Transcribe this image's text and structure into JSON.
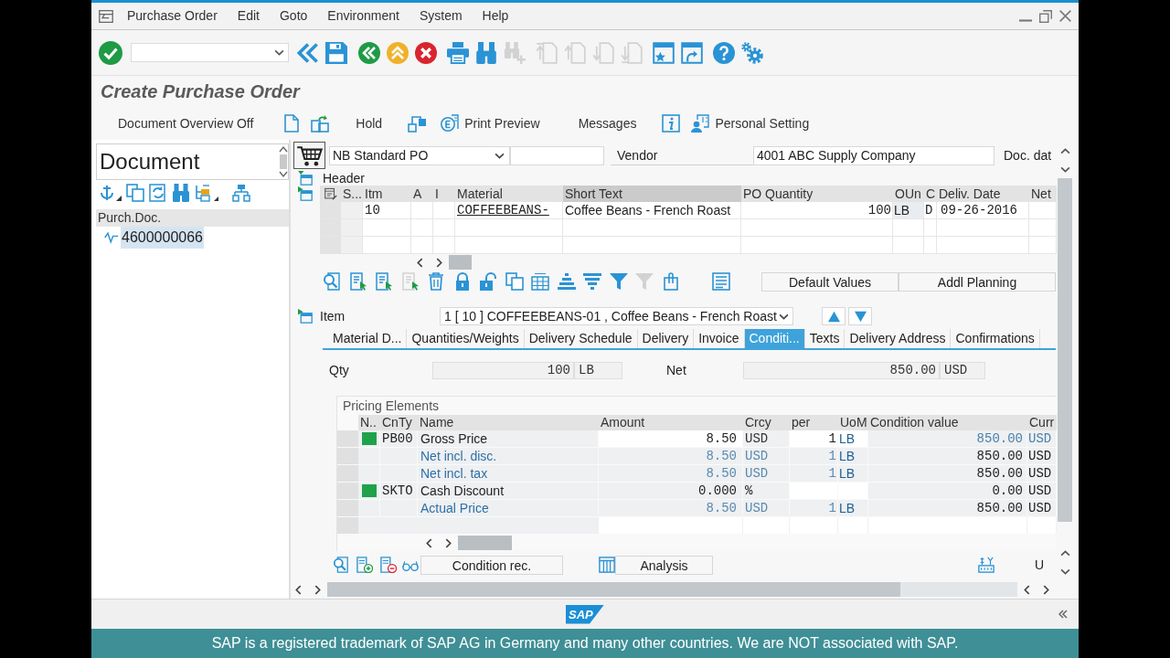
{
  "window": {
    "menu": [
      "Purchase Order",
      "Edit",
      "Goto",
      "Environment",
      "System",
      "Help"
    ]
  },
  "toolbar": {
    "buttons": [
      {
        "disabled": false
      },
      {
        "disabled": false
      },
      {
        "disabled": false
      },
      {
        "disabled": false
      },
      {
        "disabled": false
      },
      {
        "disabled": false
      },
      {
        "disabled": false
      },
      {
        "disabled": true
      },
      {
        "disabled": true
      },
      {
        "disabled": true
      },
      {
        "disabled": true
      },
      {
        "disabled": true
      },
      {
        "disabled": false
      },
      {
        "disabled": false
      },
      {
        "disabled": false
      },
      {
        "disabled": false
      }
    ]
  },
  "title": "Create Purchase Order",
  "app_toolbar": [
    {
      "label": "Document Overview Off"
    },
    {
      "label": "Hold"
    },
    {
      "label": "Print Preview"
    },
    {
      "label": "Messages"
    },
    {
      "label": "Personal Setting"
    }
  ],
  "document_pane": {
    "title": "Document",
    "tree_header": "Purch.Doc.",
    "tree": [
      {
        "label": "4600000066",
        "selected": true
      }
    ]
  },
  "header": {
    "doc_type": "NB Standard PO",
    "vendor_label": "Vendor",
    "vendor": "4001 ABC Supply Company",
    "doc_date_label": "Doc. dat",
    "section": "Header"
  },
  "items_table": {
    "columns": [
      {
        "label": "S...",
        "selected": false
      },
      {
        "label": "Itm",
        "selected": false
      },
      {
        "label": "A",
        "selected": false
      },
      {
        "label": "I",
        "selected": false
      },
      {
        "label": "Material",
        "selected": false
      },
      {
        "label": "Short Text",
        "selected": true
      },
      {
        "label": "PO Quantity",
        "selected": false
      },
      {
        "label": "OUn",
        "selected": false
      },
      {
        "label": "C",
        "selected": false
      },
      {
        "label": "Deliv. Date",
        "selected": false
      },
      {
        "label": "Net",
        "selected": false
      }
    ],
    "rows": [
      {
        "itm": "10",
        "material": "COFFEEBEANS-",
        "short_text": "Coffee Beans - French Roast",
        "po_quantity": "100",
        "oun": "LB",
        "c": "D",
        "deliv_date": "09-26-2016"
      }
    ]
  },
  "table_toolbar": {
    "icons": [
      {
        "disabled": false
      },
      {
        "disabled": false
      },
      {
        "disabled": false
      },
      {
        "disabled": true
      },
      {
        "disabled": false
      },
      {
        "disabled": false
      },
      {
        "disabled": false
      },
      {
        "disabled": false
      },
      {
        "disabled": false
      },
      {
        "disabled": false
      },
      {
        "disabled": false
      },
      {
        "disabled": false
      },
      {
        "disabled": true
      },
      {
        "disabled": false
      },
      {
        "disabled": false
      }
    ],
    "buttons": [
      "Default Values",
      "Addl Planning"
    ]
  },
  "item_detail": {
    "label": "Item",
    "selector": "1 [ 10 ] COFFEEBEANS-01 , Coffee Beans - French Roast",
    "tabs": [
      {
        "label": "Material D...",
        "selected": false
      },
      {
        "label": "Quantities/Weights",
        "selected": false
      },
      {
        "label": "Delivery Schedule",
        "selected": false
      },
      {
        "label": "Delivery",
        "selected": false
      },
      {
        "label": "Invoice",
        "selected": false
      },
      {
        "label": "Conditi...",
        "selected": true
      },
      {
        "label": "Texts",
        "selected": false
      },
      {
        "label": "Delivery Address",
        "selected": false
      },
      {
        "label": "Confirmations",
        "selected": false
      }
    ],
    "qty_label": "Qty",
    "qty": "100",
    "qty_unit": "LB",
    "net_label": "Net",
    "net": "850.00",
    "net_currency": "USD"
  },
  "pricing": {
    "title": "Pricing Elements",
    "columns": [
      "N..",
      "CnTy",
      "Name",
      "Amount",
      "Crcy",
      "per",
      "UoM",
      "Condition value",
      "Curr"
    ],
    "rows": [
      {
        "kind": "price",
        "color": "#1fa24a",
        "cnty": "PB00",
        "name": "Gross Price",
        "amount": "8.50",
        "crcy": "USD",
        "per": "1",
        "uom": "LB",
        "condition_value": "850.00",
        "curr": "USD"
      },
      {
        "kind": "subtotal",
        "name": "Net incl. disc.",
        "amount": "8.50",
        "crcy": "USD",
        "per": "1",
        "uom": "LB",
        "condition_value": "850.00",
        "curr": "USD"
      },
      {
        "kind": "subtotal",
        "name": "Net incl. tax",
        "amount": "8.50",
        "crcy": "USD",
        "per": "1",
        "uom": "LB",
        "condition_value": "850.00",
        "curr": "USD"
      },
      {
        "kind": "discount",
        "color": "#1fa24a",
        "cnty": "SKTO",
        "name": "Cash Discount",
        "amount": "0.000",
        "crcy": "%",
        "condition_value": "0.00",
        "curr": "USD"
      },
      {
        "kind": "subtotal",
        "name": "Actual Price",
        "amount": "8.50",
        "crcy": "USD",
        "per": "1",
        "uom": "LB",
        "condition_value": "850.00",
        "curr": "USD"
      }
    ]
  },
  "pricing_toolbar": {
    "buttons": [
      "Condition rec.",
      "Analysis",
      "U"
    ]
  },
  "status_bar": {
    "logo": "SAP"
  },
  "caption": "SAP is a registered trademark of SAP AG in Germany and many other countries. We are NOT associated with SAP."
}
